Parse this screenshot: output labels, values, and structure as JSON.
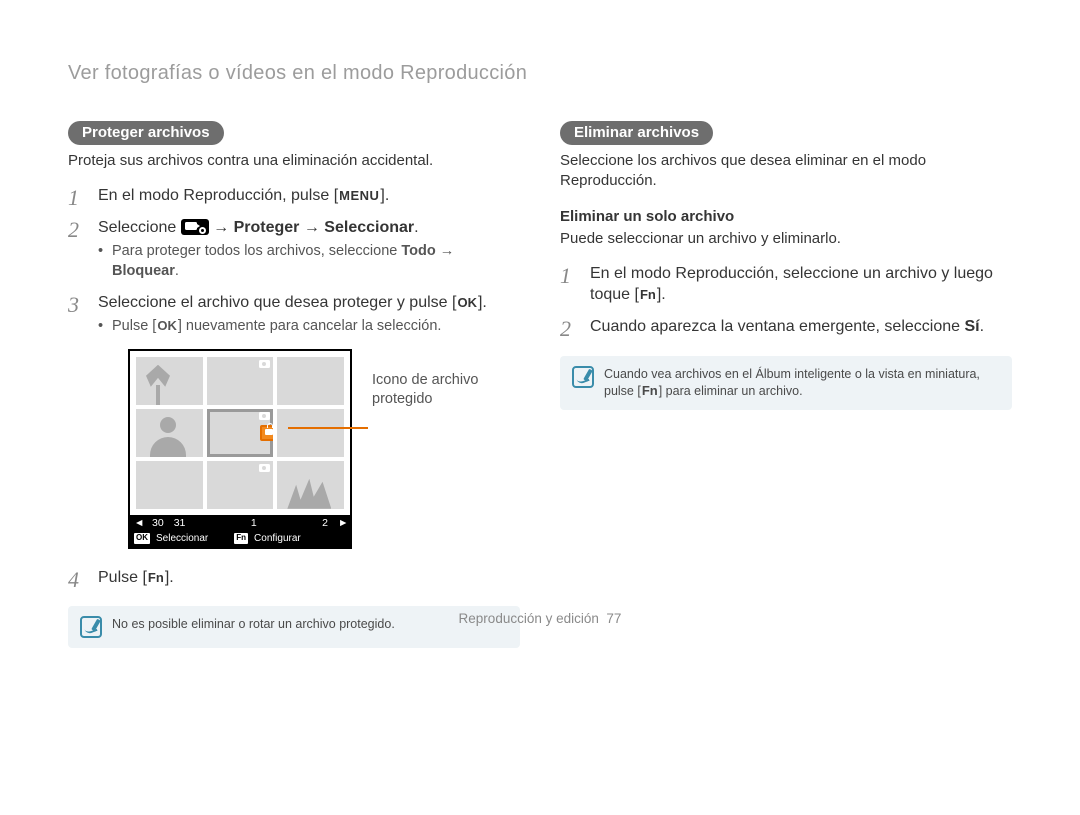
{
  "page_title": "Ver fotografías o vídeos en el modo Reproducción",
  "left": {
    "pill": "Proteger archivos",
    "intro": "Proteja sus archivos contra una eliminación accidental.",
    "steps": {
      "1": {
        "pre": "En el modo Reproducción, pulse [",
        "key": "MENU",
        "post": "]."
      },
      "2": {
        "pre": "Seleccione ",
        "arrow": " → ",
        "b1": "Proteger",
        "arrow2": " → ",
        "b2": "Seleccionar",
        "post": ".",
        "sub": {
          "text": "Para proteger todos los archivos, seleccione ",
          "bold": "Todo",
          "arrow": " → ",
          "bold2": "Bloquear",
          "post": "."
        }
      },
      "3": {
        "text": "Seleccione el archivo que desea proteger y pulse [",
        "key": "OK",
        "post": "].",
        "sub": {
          "pre": "Pulse [",
          "key": "OK",
          "post": "] nuevamente para cancelar la selección."
        }
      },
      "4": {
        "pre": "Pulse [",
        "key": "Fn",
        "post": "]."
      }
    },
    "callout": "Icono de archivo protegido",
    "datebar": {
      "d1": "30",
      "d2": "31",
      "d3": "1",
      "d4": "2"
    },
    "actionbar": {
      "ok": "OK",
      "ok_label": "Seleccionar",
      "fn": "Fn",
      "fn_label": "Configurar"
    },
    "note": "No es posible eliminar o rotar un archivo protegido."
  },
  "right": {
    "pill": "Eliminar archivos",
    "intro": "Seleccione los archivos que desea eliminar en el modo Reproducción.",
    "h4": "Eliminar un solo archivo",
    "h4_sub": "Puede seleccionar un archivo y eliminarlo.",
    "steps": {
      "1": {
        "pre": "En el modo Reproducción, seleccione un archivo y luego toque [",
        "key": "Fn",
        "post": "]."
      },
      "2": {
        "pre": "Cuando aparezca la ventana emergente, seleccione ",
        "bold": "Sí",
        "post": "."
      }
    },
    "note": {
      "pre": "Cuando vea archivos en el Álbum inteligente o la vista en miniatura, pulse [",
      "key": "Fn",
      "post": "] para eliminar un archivo."
    }
  },
  "footer": {
    "section": "Reproducción y edición",
    "page": "77"
  }
}
